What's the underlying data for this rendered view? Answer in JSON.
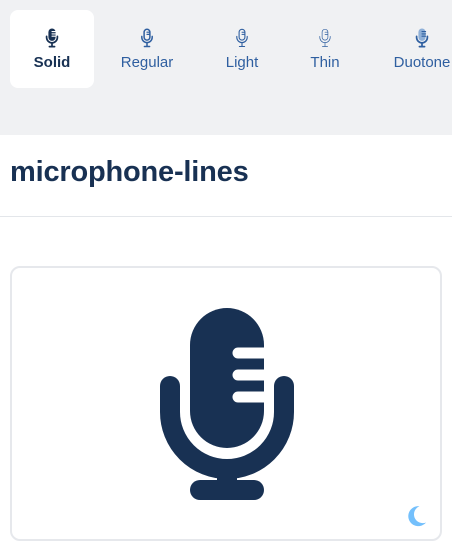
{
  "tabs": [
    {
      "label": "Solid",
      "icon": "microphone-lines-icon",
      "active": true
    },
    {
      "label": "Regular",
      "icon": "microphone-lines-icon",
      "active": false
    },
    {
      "label": "Light",
      "icon": "microphone-lines-icon",
      "active": false
    },
    {
      "label": "Thin",
      "icon": "microphone-lines-icon",
      "active": false
    },
    {
      "label": "Duotone",
      "icon": "microphone-lines-icon",
      "active": false
    }
  ],
  "icon_name": "microphone-lines",
  "preview": {
    "icon": "microphone-lines-icon",
    "toggle_icon": "moon-icon"
  },
  "colors": {
    "navy": "#183153",
    "tab_label": "#2f5fa0",
    "tabbar_bg": "#f0f1f3",
    "moon": "#74c0fc"
  }
}
